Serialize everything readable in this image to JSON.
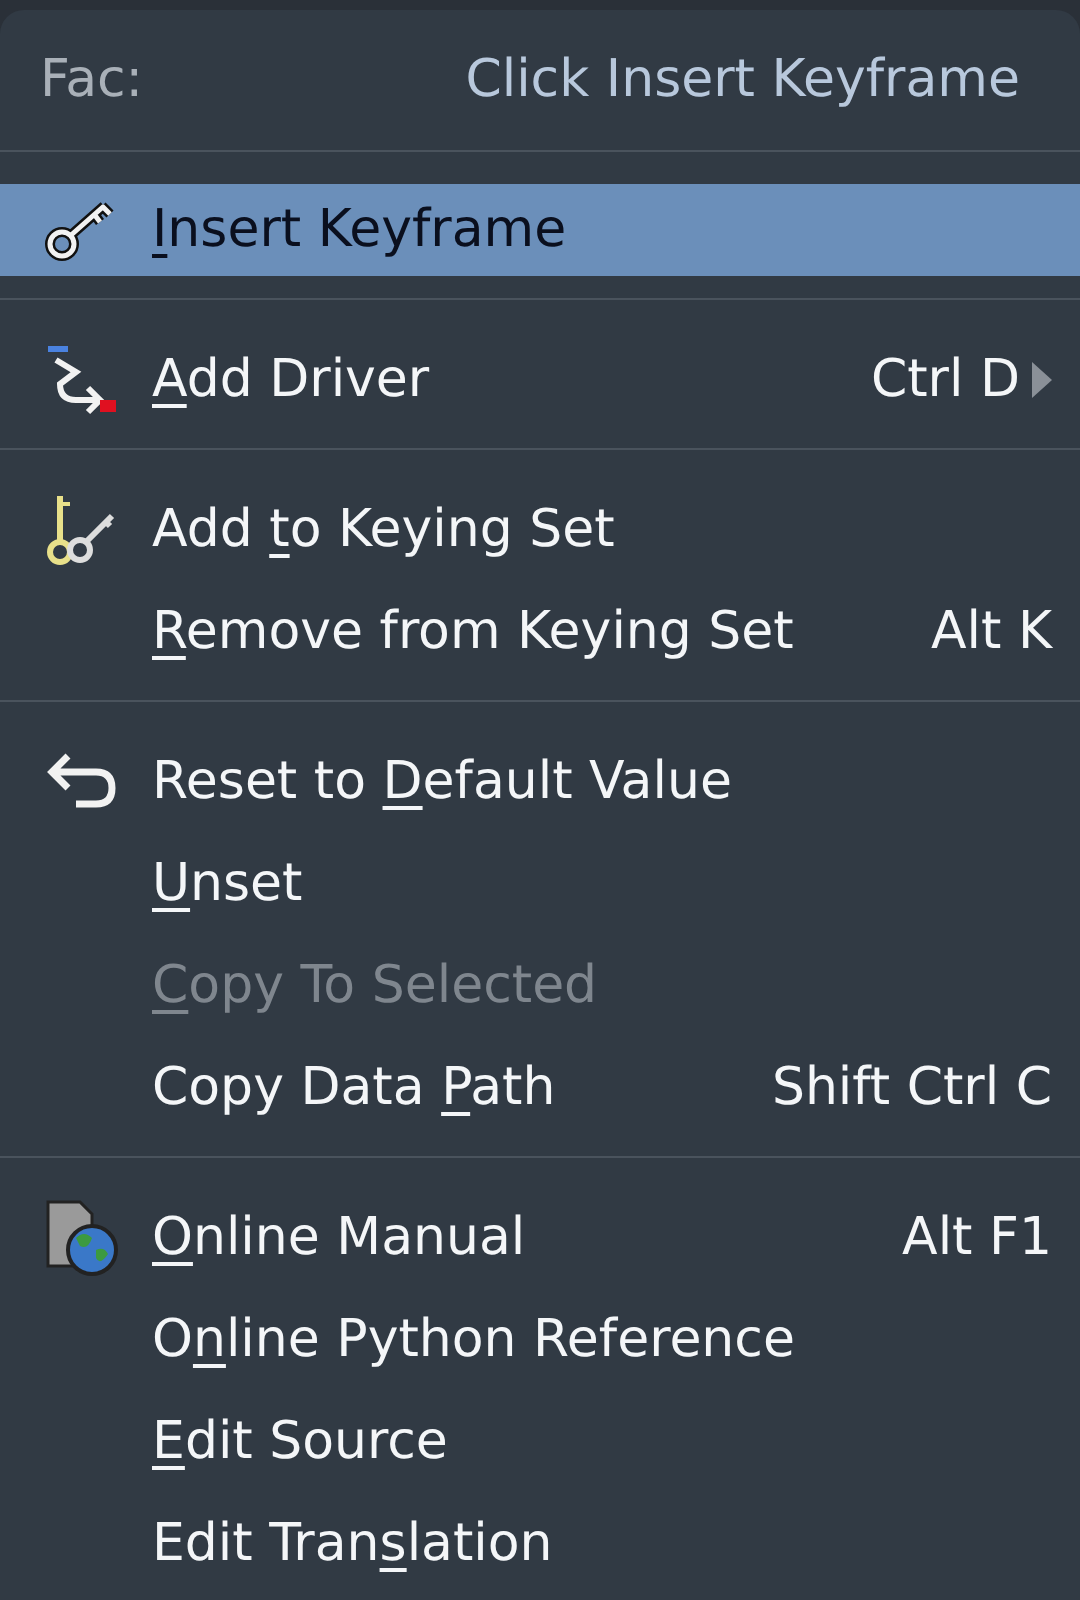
{
  "header": {
    "label": "Fac:",
    "hint": "Click Insert Keyframe"
  },
  "sections": [
    {
      "items": [
        {
          "kind": "key",
          "label": {
            "key": "I",
            "after": "nsert Keyframe"
          },
          "selected": true,
          "disabled": false,
          "submenu": false
        }
      ]
    },
    {
      "items": [
        {
          "kind": "driver",
          "label": {
            "key": "A",
            "after": "dd Driver"
          },
          "shortcut": "Ctrl D",
          "selected": false,
          "disabled": false,
          "submenu": true
        }
      ]
    },
    {
      "items": [
        {
          "kind": "keyingset",
          "label": {
            "before": "Add ",
            "key": "t",
            "after": "o Keying Set"
          },
          "selected": false,
          "disabled": false,
          "submenu": false
        },
        {
          "kind": "plain",
          "label": {
            "key": "R",
            "after": "emove from Keying Set"
          },
          "shortcut": "Alt K",
          "selected": false,
          "disabled": false,
          "submenu": false
        }
      ]
    },
    {
      "items": [
        {
          "kind": "reset",
          "label": {
            "before": "Reset to ",
            "key": "D",
            "after": "efault Value"
          },
          "selected": false,
          "disabled": false,
          "submenu": false
        },
        {
          "kind": "plain",
          "label": {
            "key": "U",
            "after": "nset"
          },
          "selected": false,
          "disabled": false,
          "submenu": false
        },
        {
          "kind": "plain",
          "label": {
            "key": "C",
            "after": "opy To Selected"
          },
          "selected": false,
          "disabled": true,
          "submenu": false
        },
        {
          "kind": "plain",
          "label": {
            "before": "Copy Data ",
            "key": "P",
            "after": "ath"
          },
          "shortcut": "Shift Ctrl C",
          "selected": false,
          "disabled": false,
          "submenu": false
        }
      ]
    },
    {
      "items": [
        {
          "kind": "manual",
          "label": {
            "key": "O",
            "after": "nline Manual"
          },
          "shortcut": "Alt F1",
          "selected": false,
          "disabled": false,
          "submenu": false
        },
        {
          "kind": "plain",
          "label": {
            "before": "O",
            "key": "n",
            "after": "line Python Reference"
          },
          "selected": false,
          "disabled": false,
          "submenu": false
        },
        {
          "kind": "plain",
          "label": {
            "key": "E",
            "after": "dit Source"
          },
          "selected": false,
          "disabled": false,
          "submenu": false
        },
        {
          "kind": "plain",
          "label": {
            "before": "Edit Tran",
            "key": "s",
            "after": "lation"
          },
          "selected": false,
          "disabled": false,
          "submenu": false
        }
      ]
    }
  ]
}
